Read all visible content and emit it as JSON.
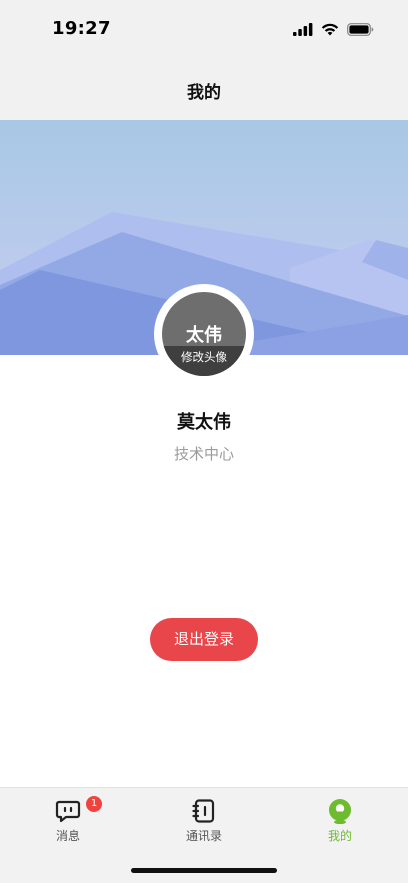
{
  "status_bar": {
    "time": "19:27"
  },
  "nav": {
    "title": "我的"
  },
  "profile": {
    "avatar_initials": "太伟",
    "avatar_edit_label": "修改头像",
    "name": "莫太伟",
    "department": "技术中心"
  },
  "actions": {
    "logout_label": "退出登录"
  },
  "tab_bar": {
    "items": [
      {
        "label": "消息",
        "icon": "message-icon",
        "badge": "1"
      },
      {
        "label": "通讯录",
        "icon": "contacts-icon"
      },
      {
        "label": "我的",
        "icon": "profile-icon",
        "active": true
      }
    ]
  },
  "colors": {
    "accent_green": "#6dbb2e",
    "logout_red": "#e8464a",
    "badge_red": "#f0433f"
  }
}
